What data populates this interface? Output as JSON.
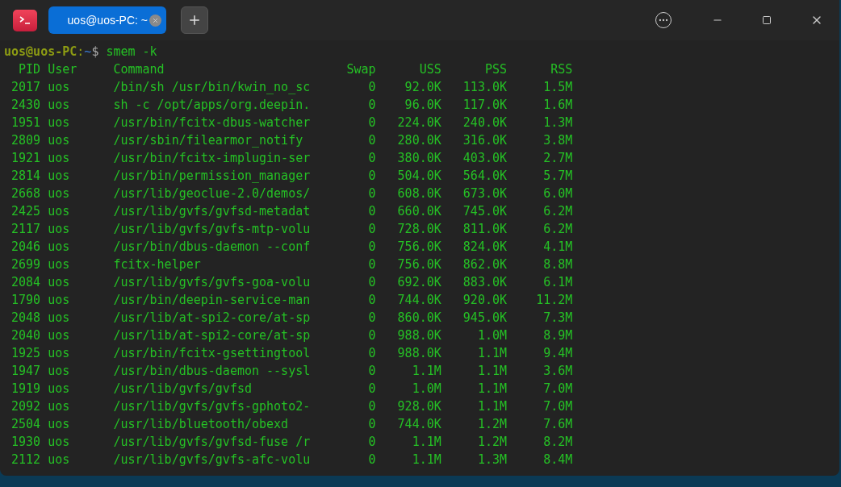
{
  "tabs": [
    {
      "label": "uos@uos-PC: ~",
      "selected": true
    }
  ],
  "prompt": {
    "user_host": "uos@uos-PC",
    "separator": ":",
    "path": "~",
    "symbol": "$",
    "command": "smem -k"
  },
  "table": {
    "columns": [
      "PID",
      "User",
      "Command",
      "Swap",
      "USS",
      "PSS",
      "RSS"
    ],
    "rows": [
      [
        "2017",
        "uos",
        "/bin/sh /usr/bin/kwin_no_sc",
        "0",
        "92.0K",
        "113.0K",
        "1.5M"
      ],
      [
        "2430",
        "uos",
        "sh -c /opt/apps/org.deepin.",
        "0",
        "96.0K",
        "117.0K",
        "1.6M"
      ],
      [
        "1951",
        "uos",
        "/usr/bin/fcitx-dbus-watcher",
        "0",
        "224.0K",
        "240.0K",
        "1.3M"
      ],
      [
        "2809",
        "uos",
        "/usr/sbin/filearmor_notify",
        "0",
        "280.0K",
        "316.0K",
        "3.8M"
      ],
      [
        "1921",
        "uos",
        "/usr/bin/fcitx-implugin-ser",
        "0",
        "380.0K",
        "403.0K",
        "2.7M"
      ],
      [
        "2814",
        "uos",
        "/usr/bin/permission_manager",
        "0",
        "504.0K",
        "564.0K",
        "5.7M"
      ],
      [
        "2668",
        "uos",
        "/usr/lib/geoclue-2.0/demos/",
        "0",
        "608.0K",
        "673.0K",
        "6.0M"
      ],
      [
        "2425",
        "uos",
        "/usr/lib/gvfs/gvfsd-metadat",
        "0",
        "660.0K",
        "745.0K",
        "6.2M"
      ],
      [
        "2117",
        "uos",
        "/usr/lib/gvfs/gvfs-mtp-volu",
        "0",
        "728.0K",
        "811.0K",
        "6.2M"
      ],
      [
        "2046",
        "uos",
        "/usr/bin/dbus-daemon --conf",
        "0",
        "756.0K",
        "824.0K",
        "4.1M"
      ],
      [
        "2699",
        "uos",
        "fcitx-helper",
        "0",
        "756.0K",
        "862.0K",
        "8.8M"
      ],
      [
        "2084",
        "uos",
        "/usr/lib/gvfs/gvfs-goa-volu",
        "0",
        "692.0K",
        "883.0K",
        "6.1M"
      ],
      [
        "1790",
        "uos",
        "/usr/bin/deepin-service-man",
        "0",
        "744.0K",
        "920.0K",
        "11.2M"
      ],
      [
        "2048",
        "uos",
        "/usr/lib/at-spi2-core/at-sp",
        "0",
        "860.0K",
        "945.0K",
        "7.3M"
      ],
      [
        "2040",
        "uos",
        "/usr/lib/at-spi2-core/at-sp",
        "0",
        "988.0K",
        "1.0M",
        "8.9M"
      ],
      [
        "1925",
        "uos",
        "/usr/bin/fcitx-gsettingtool",
        "0",
        "988.0K",
        "1.1M",
        "9.4M"
      ],
      [
        "1947",
        "uos",
        "/usr/bin/dbus-daemon --sysl",
        "0",
        "1.1M",
        "1.1M",
        "3.6M"
      ],
      [
        "1919",
        "uos",
        "/usr/lib/gvfs/gvfsd",
        "0",
        "1.0M",
        "1.1M",
        "7.0M"
      ],
      [
        "2092",
        "uos",
        "/usr/lib/gvfs/gvfs-gphoto2-",
        "0",
        "928.0K",
        "1.1M",
        "7.0M"
      ],
      [
        "2504",
        "uos",
        "/usr/lib/bluetooth/obexd",
        "0",
        "744.0K",
        "1.2M",
        "7.6M"
      ],
      [
        "1930",
        "uos",
        "/usr/lib/gvfs/gvfsd-fuse /r",
        "0",
        "1.1M",
        "1.2M",
        "8.2M"
      ],
      [
        "2112",
        "uos",
        "/usr/lib/gvfs/gvfs-afc-volu",
        "0",
        "1.1M",
        "1.3M",
        "8.4M"
      ]
    ]
  }
}
